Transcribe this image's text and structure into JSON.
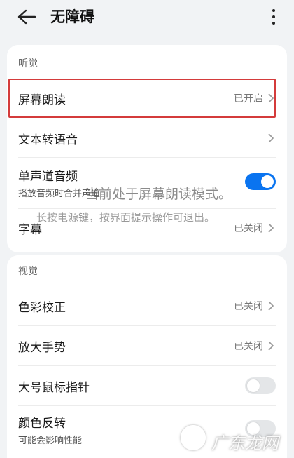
{
  "header": {
    "title": "无障碍",
    "back_icon": "arrow-left-icon",
    "more_icon": "more-vertical-icon"
  },
  "hearing": {
    "section_title": "听觉",
    "rows": [
      {
        "label": "屏幕朗读",
        "status": "已开启"
      },
      {
        "label": "文本转语音"
      },
      {
        "label": "单声道音频",
        "sub": "播放音频时合并声道",
        "toggle": true
      },
      {
        "label": "字幕",
        "status": "已关闭"
      }
    ]
  },
  "vision": {
    "section_title": "视觉",
    "rows": [
      {
        "label": "色彩校正",
        "status": "已关闭"
      },
      {
        "label": "放大手势",
        "status": "已关闭"
      },
      {
        "label": "大号鼠标指针",
        "toggle": false
      },
      {
        "label": "颜色反转",
        "sub": "可能会影响性能",
        "toggle": false
      }
    ]
  },
  "toast": {
    "line1": "当前处于屏幕朗读模式。",
    "line2": "长按电源键，按界面提示操作可退出。"
  },
  "watermark": {
    "text": "广东龙网"
  },
  "colors": {
    "accent": "#0a74f0",
    "highlight_border": "#d43b3b",
    "background": "#f1f3f5"
  }
}
